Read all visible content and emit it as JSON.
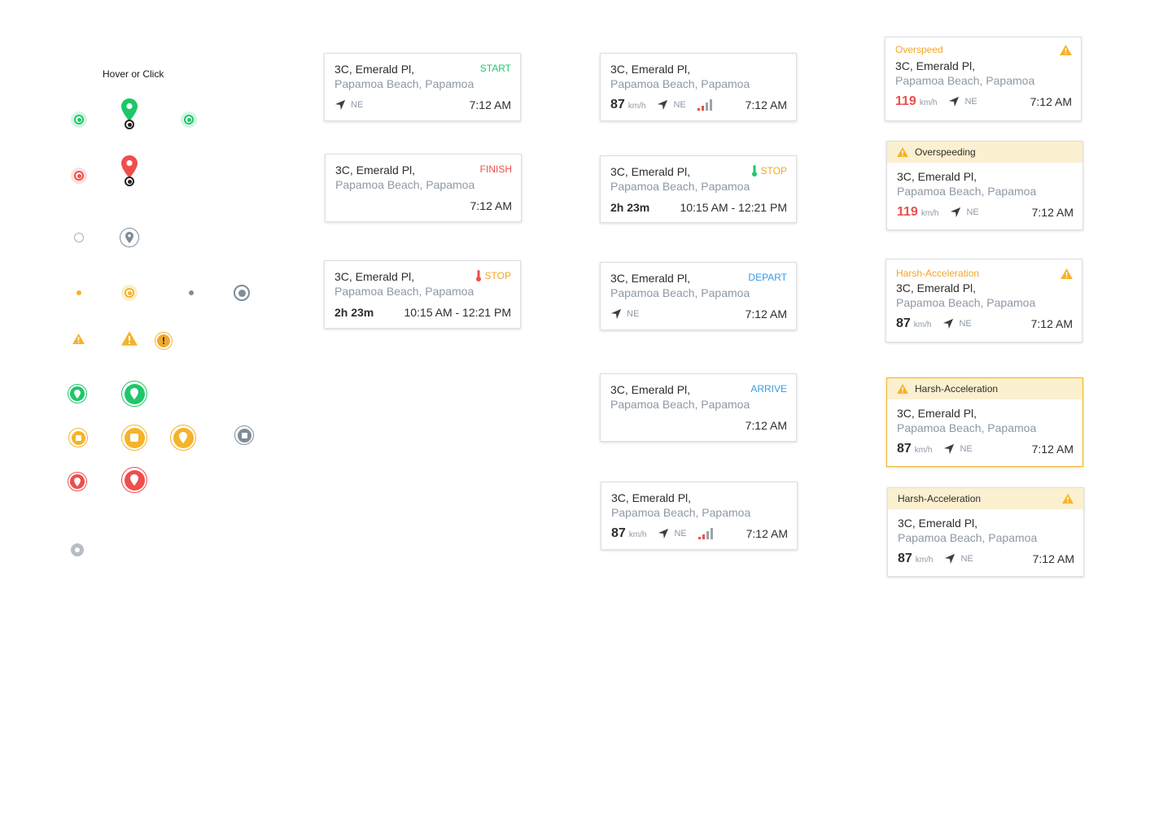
{
  "hover_label": "Hover or Click",
  "colors": {
    "green": "#1ec769",
    "red": "#f04d4d",
    "orange": "#f5b32a",
    "gray": "#7f8c99",
    "blue": "#3b9ae1"
  },
  "address": {
    "line1": "3C, Emerald Pl,",
    "line2": "Papamoa Beach, Papamoa"
  },
  "col1": {
    "start": {
      "status": "START",
      "direction": "NE",
      "time": "7:12 AM"
    },
    "finish": {
      "status": "FINISH",
      "time": "7:12 AM"
    },
    "stop": {
      "status": "STOP",
      "duration": "2h 23m",
      "range": "10:15 AM - 12:21 PM"
    }
  },
  "col2": {
    "moving": {
      "speed": "87",
      "unit": "km/h",
      "direction": "NE",
      "time": "7:12 AM"
    },
    "stop": {
      "status": "STOP",
      "duration": "2h 23m",
      "range": "10:15 AM - 12:21 PM"
    },
    "depart": {
      "status": "DEPART",
      "direction": "NE",
      "time": "7:12 AM"
    },
    "arrive": {
      "status": "ARRIVE",
      "time": "7:12 AM"
    },
    "moving2": {
      "speed": "87",
      "unit": "km/h",
      "direction": "NE",
      "time": "7:12 AM"
    }
  },
  "col3": {
    "overspeed": {
      "label": "Overspeed",
      "speed": "119",
      "unit": "km/h",
      "direction": "NE",
      "time": "7:12 AM"
    },
    "overspeeding": {
      "label": "Overspeeding",
      "speed": "119",
      "unit": "km/h",
      "direction": "NE",
      "time": "7:12 AM"
    },
    "harsh1": {
      "label": "Harsh-Acceleration",
      "speed": "87",
      "unit": "km/h",
      "direction": "NE",
      "time": "7:12 AM"
    },
    "harsh2": {
      "label": "Harsh-Acceleration",
      "speed": "87",
      "unit": "km/h",
      "direction": "NE",
      "time": "7:12 AM"
    },
    "harsh3": {
      "label": "Harsh-Acceleration",
      "speed": "87",
      "unit": "km/h",
      "direction": "NE",
      "time": "7:12 AM"
    }
  }
}
